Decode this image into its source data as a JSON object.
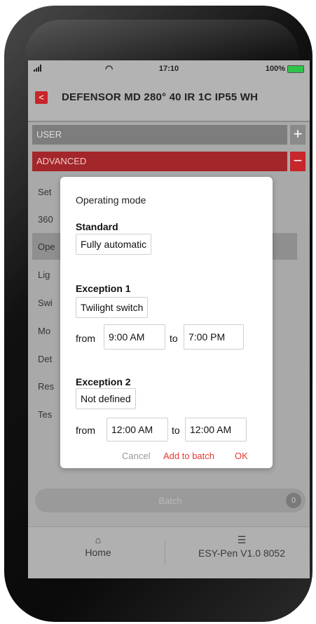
{
  "status": {
    "time": "17:10",
    "battery": "100%"
  },
  "app": {
    "back_label": "<",
    "title": "DEFENSOR MD 280° 40 IR 1C IP55 WH"
  },
  "sections": {
    "user": "USER",
    "advanced": "ADVANCED",
    "expand_symbol": "+",
    "collapse_symbol": "−"
  },
  "list_items": [
    "Set",
    "360",
    "Ope",
    "Lig",
    "Swi",
    "Mo",
    "Det",
    "Res",
    "Tes"
  ],
  "modal": {
    "title": "Operating mode",
    "standard": {
      "heading": "Standard",
      "value": "Fully automatic"
    },
    "exception1": {
      "heading": "Exception 1",
      "value": "Twilight switch",
      "from_label": "from",
      "from": "9:00 AM",
      "to_label": "to",
      "to": "7:00 PM"
    },
    "exception2": {
      "heading": "Exception 2",
      "value": "Not defined",
      "from_label": "from",
      "from": "12:00 AM",
      "to_label": "to",
      "to": "12:00 AM"
    },
    "cancel": "Cancel",
    "add_to_batch": "Add to batch",
    "ok": "OK"
  },
  "batch": {
    "label": "Batch",
    "count": "0"
  },
  "tabbar": {
    "home": "Home",
    "pen": "ESY-Pen V1.0 8052"
  },
  "colors": {
    "accent": "#c7262b",
    "action": "#e53935",
    "battery": "#2ec44a"
  }
}
